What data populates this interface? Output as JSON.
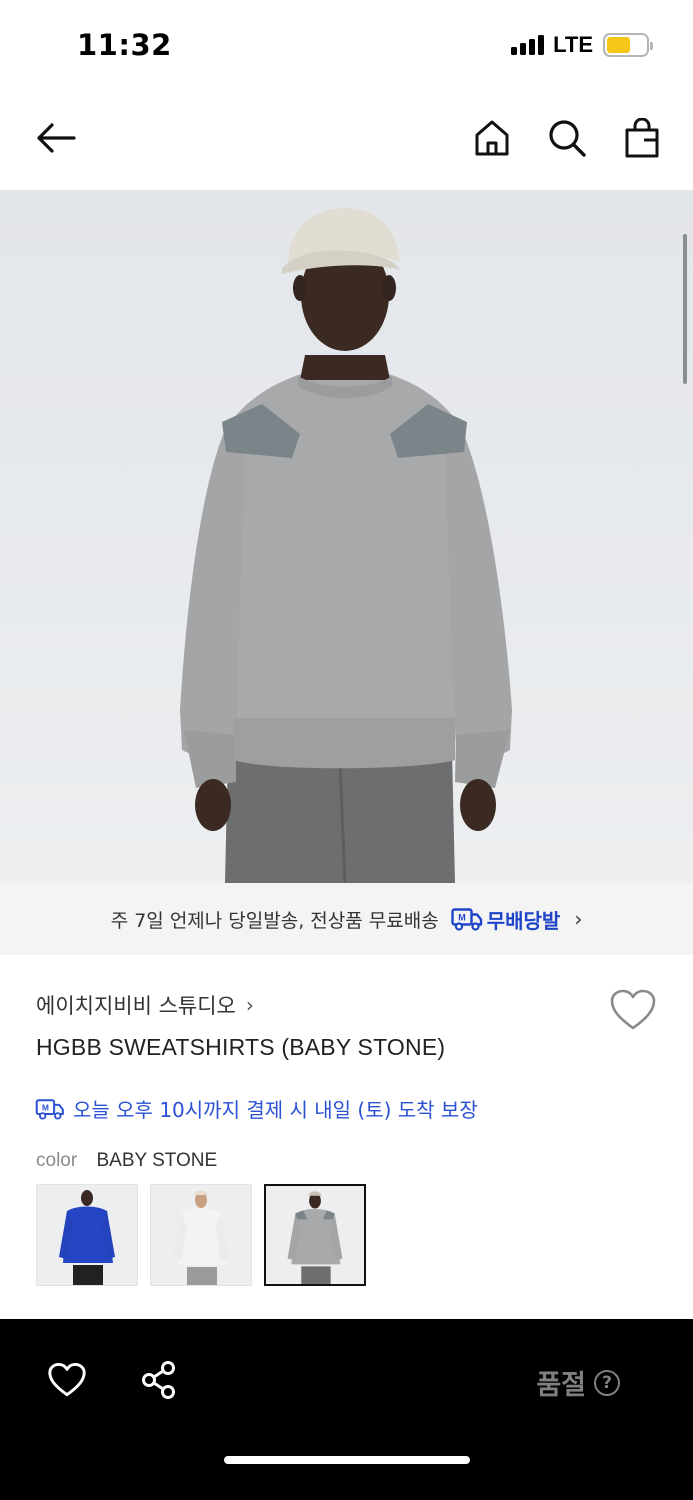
{
  "status_bar": {
    "time": "11:32",
    "network": "LTE"
  },
  "header": {
    "back_icon": "arrow-left-icon",
    "home_icon": "home-icon",
    "search_icon": "search-icon",
    "bag_icon": "shopping-bag-icon"
  },
  "banner": {
    "text": "주 7일 언제나 당일발송, 전상품 무료배송",
    "badge_label": "무배당발",
    "badge_icon": "delivery-truck-icon"
  },
  "product": {
    "brand": "에이치지비비 스튜디오",
    "name": "HGBB SWEATSHIRTS (BABY STONE)",
    "delivery": "오늘 오후 10시까지 결제 시 내일 (토) 도착 보장",
    "color_label": "color",
    "color_value": "BABY STONE",
    "swatches": [
      {
        "color": "#2546c4",
        "selected": false
      },
      {
        "color": "#f0f0f0",
        "selected": false
      },
      {
        "color": "#9fa3a6",
        "selected": true
      }
    ]
  },
  "bottom_bar": {
    "wishlist_icon": "heart-icon",
    "share_icon": "share-icon",
    "soldout_label": "품절",
    "help_symbol": "?"
  }
}
